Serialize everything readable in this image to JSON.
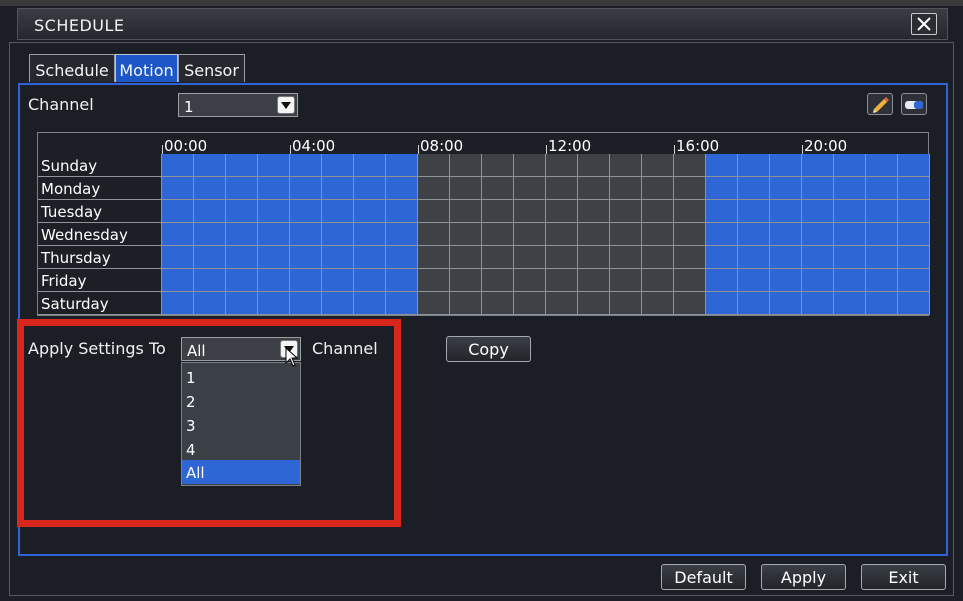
{
  "window": {
    "title": "SCHEDULE"
  },
  "tabs": [
    {
      "label": "Schedule"
    },
    {
      "label": "Motion"
    },
    {
      "label": "Sensor"
    }
  ],
  "active_tab": "Motion",
  "channel": {
    "label": "Channel",
    "value": "1"
  },
  "toolbar": {
    "edit_icon": "pencil-icon",
    "erase_icon": "eraser-icon"
  },
  "schedule": {
    "hour_labels": [
      "00:00",
      "04:00",
      "08:00",
      "12:00",
      "16:00",
      "20:00"
    ],
    "days": [
      "Sunday",
      "Monday",
      "Tuesday",
      "Wednesday",
      "Thursday",
      "Friday",
      "Saturday"
    ],
    "scheduled_hours": [
      0,
      1,
      2,
      3,
      4,
      5,
      6,
      7,
      17,
      18,
      19,
      20,
      21,
      22,
      23
    ]
  },
  "apply_settings": {
    "label": "Apply Settings To",
    "selected": "All",
    "suffix": "Channel",
    "options": [
      "1",
      "2",
      "3",
      "4",
      "All"
    ]
  },
  "buttons": {
    "copy": "Copy",
    "default": "Default",
    "apply": "Apply",
    "exit": "Exit"
  },
  "colors": {
    "scheduled": "#2e66d6",
    "unscheduled": "#3e4247",
    "highlight": "#d9261c",
    "accent": "#1d57c7"
  }
}
